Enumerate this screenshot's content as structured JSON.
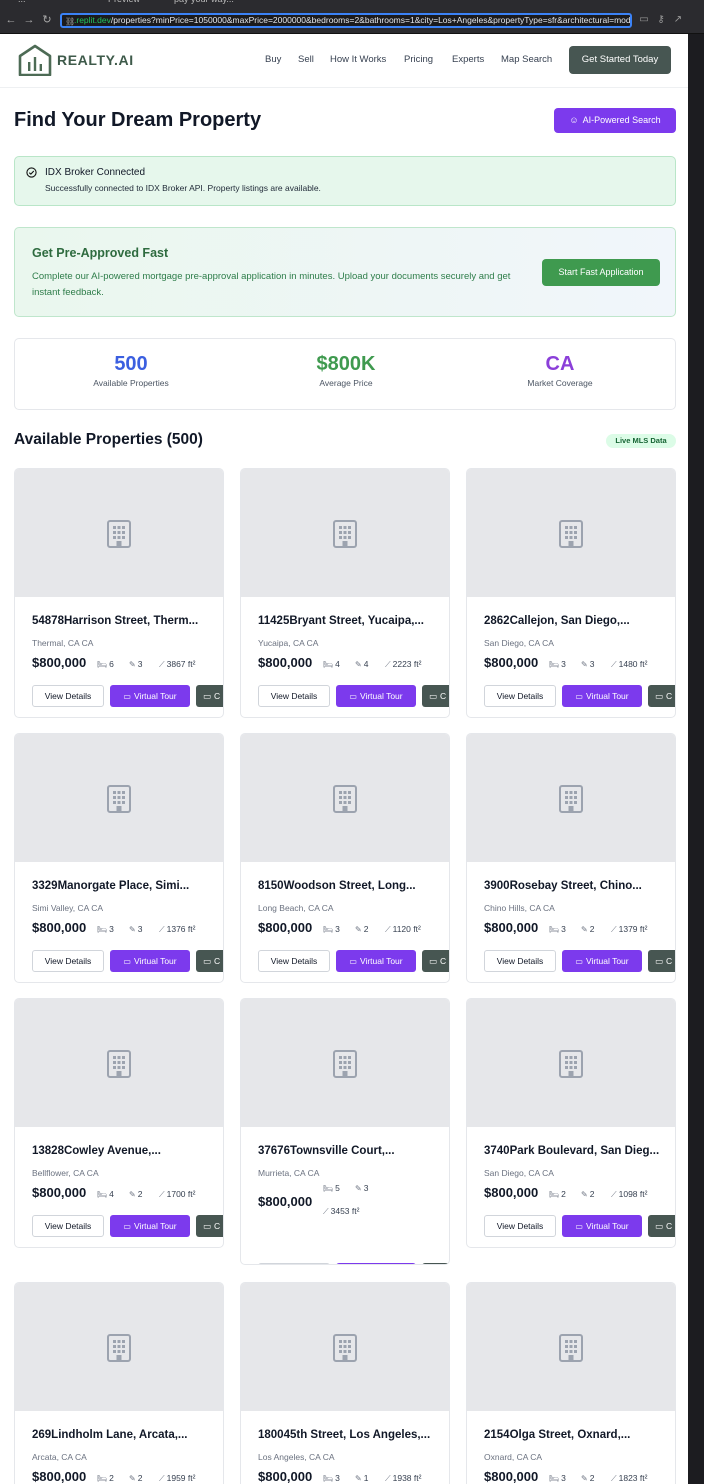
{
  "browser": {
    "tabs": [
      "...",
      "Preview",
      "pay your way..."
    ],
    "url_host": ".replit.dev",
    "url_path": "/properties?minPrice=1050000&maxPrice=2000000&bedrooms=2&bathrooms=1&city=Los+Angeles&propertyType=sfr&architectural=mod"
  },
  "header": {
    "logo_text": "REALTY.AI",
    "nav": [
      "Buy",
      "Sell",
      "How It Works",
      "Pricing",
      "Experts",
      "Map Search"
    ],
    "cta": "Get Started Today"
  },
  "page": {
    "title": "Find Your Dream Property",
    "ai_search": "AI-Powered Search"
  },
  "alert": {
    "title": "IDX Broker Connected",
    "text": "Successfully connected to IDX Broker API. Property listings are available."
  },
  "preapproval": {
    "title": "Get Pre-Approved Fast",
    "text": "Complete our AI-powered mortgage pre-approval application in minutes. Upload your documents securely and get instant feedback.",
    "button": "Start Fast Application"
  },
  "stats": [
    {
      "value": "500",
      "label": "Available Properties",
      "color": "#3b5fe0"
    },
    {
      "value": "$800K",
      "label": "Average Price",
      "color": "#3f9a4f"
    },
    {
      "value": "CA",
      "label": "Market Coverage",
      "color": "#8b3fd9"
    }
  ],
  "listings": {
    "title": "Available Properties (500)",
    "badge": "Live MLS Data",
    "view_details": "View Details",
    "virtual_tour": "Virtual Tour",
    "extra_button": "C",
    "items": [
      {
        "address": "54878Harrison Street, Therm...",
        "city": "Thermal, CA CA",
        "price": "$800,000",
        "beds": "6",
        "baths": "3",
        "sqft": "3867 ft²"
      },
      {
        "address": "11425Bryant Street, Yucaipa,...",
        "city": "Yucaipa, CA CA",
        "price": "$800,000",
        "beds": "4",
        "baths": "4",
        "sqft": "2223 ft²"
      },
      {
        "address": "2862Callejon, San Diego,...",
        "city": "San Diego, CA CA",
        "price": "$800,000",
        "beds": "3",
        "baths": "3",
        "sqft": "1480 ft²"
      },
      {
        "address": "3329Manorgate Place, Simi...",
        "city": "Simi Valley, CA CA",
        "price": "$800,000",
        "beds": "3",
        "baths": "3",
        "sqft": "1376 ft²"
      },
      {
        "address": "8150Woodson Street, Long...",
        "city": "Long Beach, CA CA",
        "price": "$800,000",
        "beds": "3",
        "baths": "2",
        "sqft": "1120 ft²"
      },
      {
        "address": "3900Rosebay Street, Chino...",
        "city": "Chino Hills, CA CA",
        "price": "$800,000",
        "beds": "3",
        "baths": "2",
        "sqft": "1379 ft²"
      },
      {
        "address": "13828Cowley Avenue,...",
        "city": "Bellflower, CA CA",
        "price": "$800,000",
        "beds": "4",
        "baths": "2",
        "sqft": "1700 ft²"
      },
      {
        "address": "37676Townsville Court,...",
        "city": "Murrieta, CA CA",
        "price": "$800,000",
        "beds": "5",
        "baths": "3",
        "sqft": "3453 ft²"
      },
      {
        "address": "3740Park Boulevard, San Dieg...",
        "city": "San Diego, CA CA",
        "price": "$800,000",
        "beds": "2",
        "baths": "2",
        "sqft": "1098 ft²"
      },
      {
        "address": "269Lindholm Lane, Arcata,...",
        "city": "Arcata, CA CA",
        "price": "$800,000",
        "beds": "2",
        "baths": "2",
        "sqft": "1959 ft²"
      },
      {
        "address": "180045th Street, Los Angeles,...",
        "city": "Los Angeles, CA CA",
        "price": "$800,000",
        "beds": "3",
        "baths": "1",
        "sqft": "1938 ft²"
      },
      {
        "address": "2154Olga Street, Oxnard,...",
        "city": "Oxnard, CA CA",
        "price": "$800,000",
        "beds": "3",
        "baths": "2",
        "sqft": "1823 ft²"
      }
    ]
  },
  "icons": {
    "building": "building-icon",
    "bed": "bed-icon",
    "bath": "bath-icon",
    "area": "area-icon",
    "camera": "video-camera-icon",
    "check": "check-circle-icon"
  }
}
